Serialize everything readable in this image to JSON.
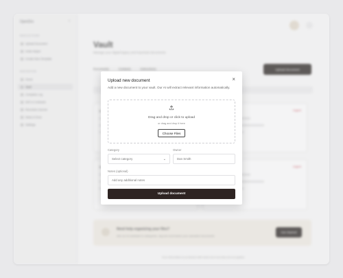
{
  "background": {
    "sidebar": {
      "brand": "OpenDrs",
      "section_main": "MAIN ACTIONS",
      "actions": [
        "Upload Document",
        "Invite Helper",
        "Create New Template"
      ],
      "section_nav": "NAVIGATION",
      "items": [
        "Home",
        "Vault",
        "Complete Log",
        "AVS & Contracts",
        "Recorded Journal",
        "Ideas & Docs",
        "Settings"
      ],
      "active_item": "Vault"
    },
    "page_title": "Vault",
    "page_subtitle": "Manage your digital legacy and important documents",
    "tabs": [
      "Documents",
      "Contacts",
      "Instructions"
    ],
    "upload_button": "Upload document",
    "cards": [
      {
        "title": "Last Will & Testament",
        "badge": "Urgent"
      },
      {
        "title": "Insurance Policy",
        "badge": "Urgent"
      },
      {
        "title": "Vehicle Title",
        "badge": "Current"
      },
      {
        "title": "Trust Document",
        "badge": "Urgent"
      }
    ],
    "help_banner": {
      "title": "Need help organizing your files?",
      "subtitle": "Ask our AI assistant to categorize, tag and summarize your uploaded documents",
      "button": "Get Started"
    },
    "footer_note": "Your information is protected with bank-level security and encryption"
  },
  "modal": {
    "title": "Upload new document",
    "close_icon": "close-icon",
    "description": "Add a new document to your vault. Our AI will extract relevant information automatically.",
    "dropzone": {
      "icon": "upload-icon",
      "text": "Drag and drop or click to upload",
      "subtext": "or drag and drop it here",
      "choose_label": "Choose Files"
    },
    "category": {
      "label": "Category",
      "placeholder": "Select category"
    },
    "owner": {
      "label": "Owner",
      "value": "Dan Smith"
    },
    "notes": {
      "label": "Notes (optional)",
      "placeholder": "Add any additional notes"
    },
    "submit_label": "Upload document",
    "colors": {
      "primary_button": "#2e2422",
      "text": "#222222",
      "muted": "#666666"
    }
  }
}
